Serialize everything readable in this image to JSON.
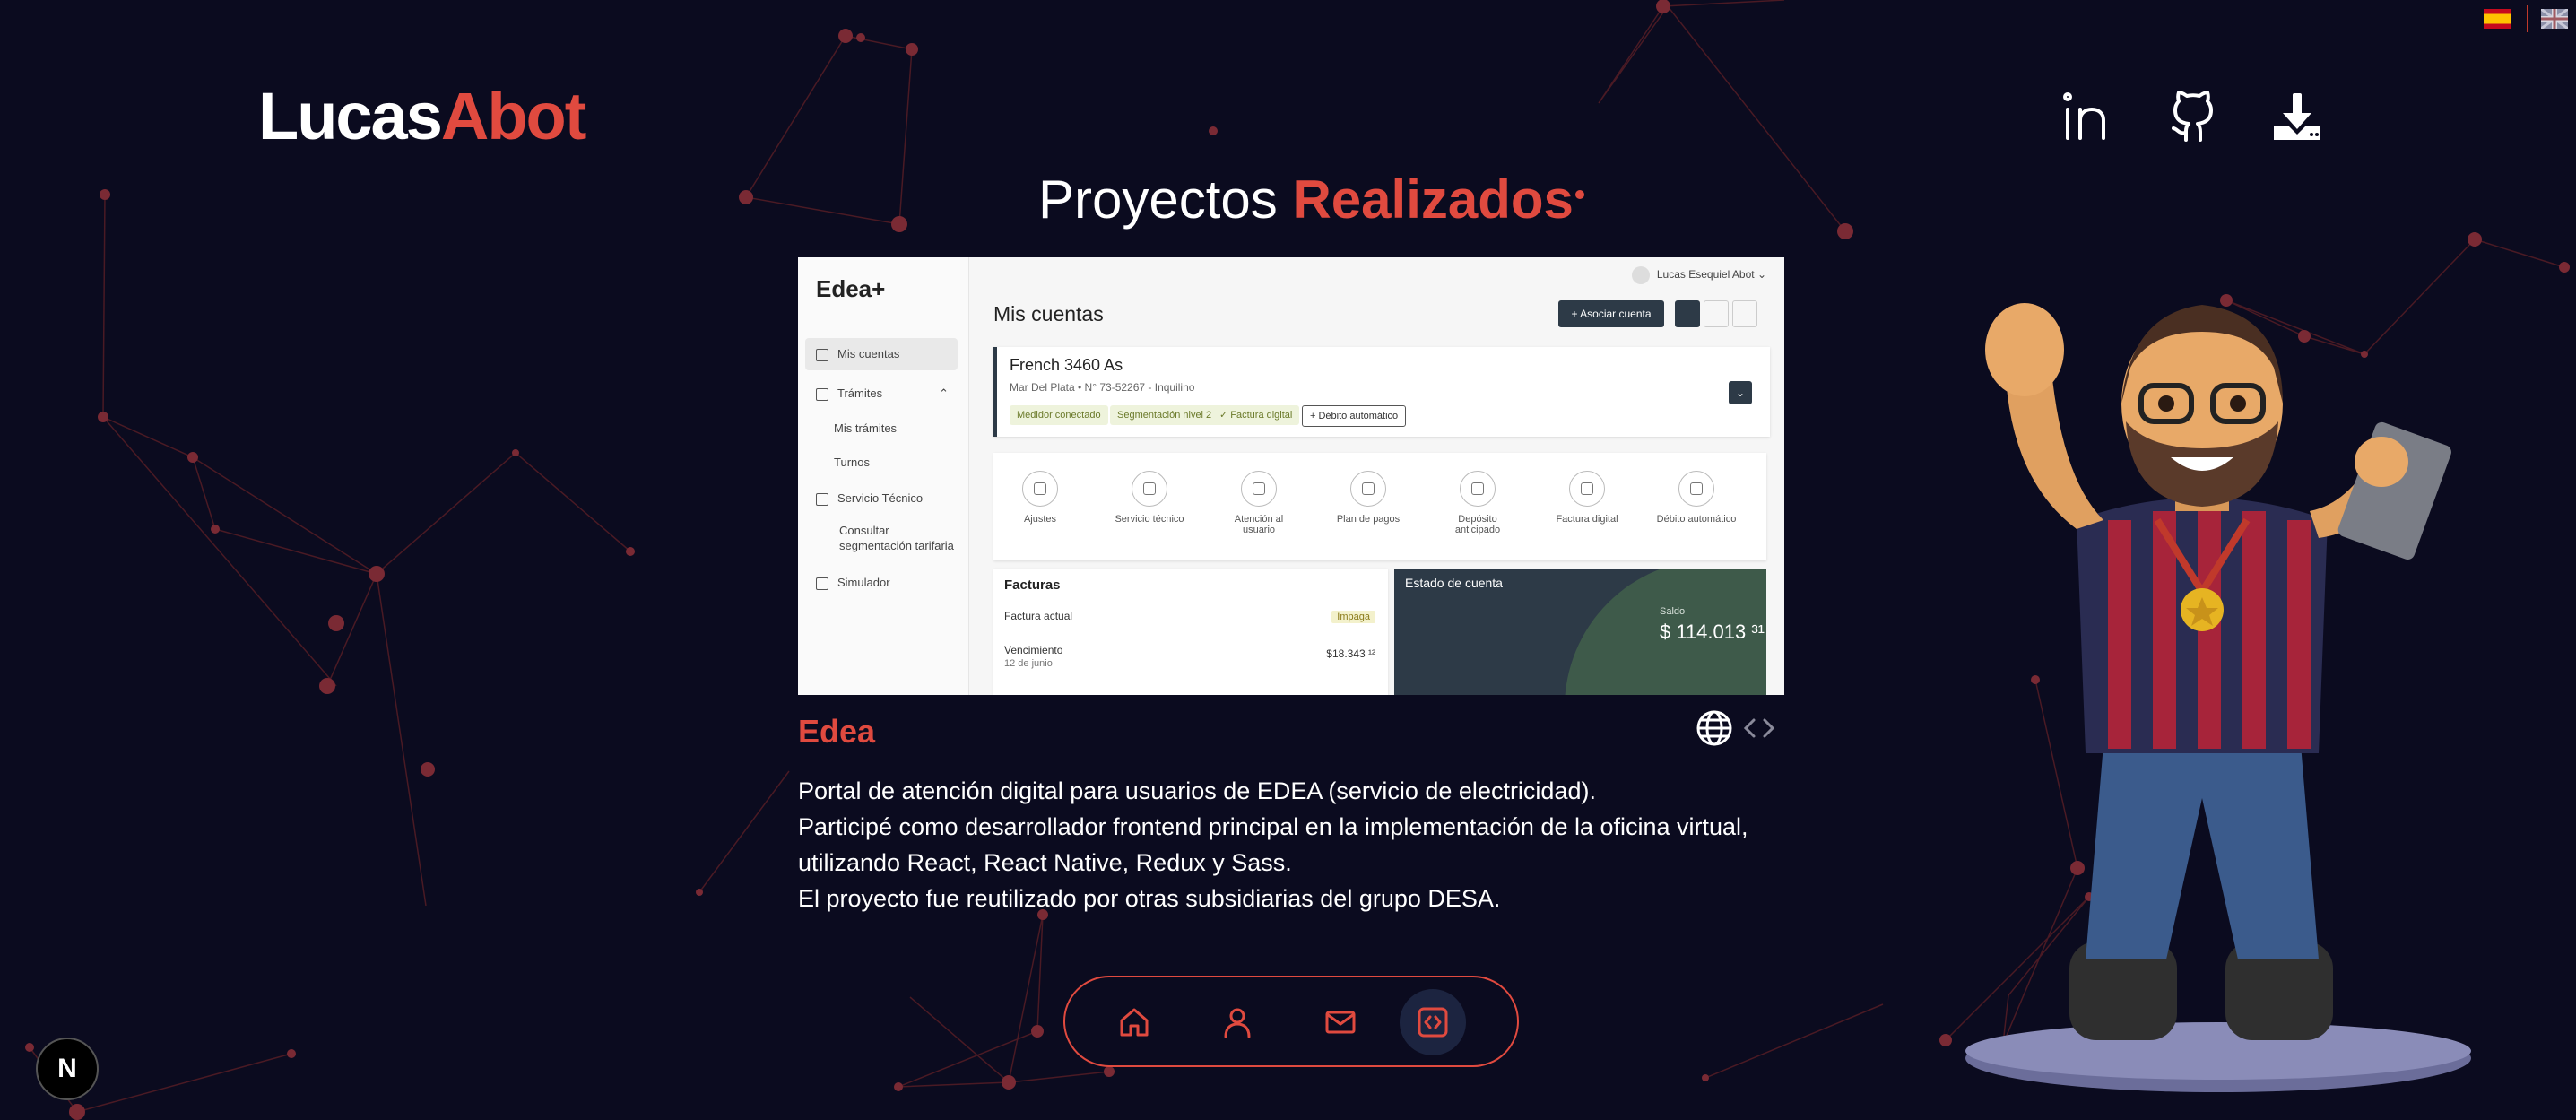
{
  "header": {
    "logo_first": "Lucas",
    "logo_second": "Abot",
    "languages": [
      "es",
      "en"
    ],
    "social": [
      {
        "name": "linkedin-icon"
      },
      {
        "name": "github-icon"
      },
      {
        "name": "download-icon"
      }
    ]
  },
  "section": {
    "title_white": "Proyectos",
    "title_red": "Realizados"
  },
  "screenshot": {
    "brand": "Edea+",
    "sidebar": [
      "Mis cuentas",
      "Trámites",
      "Mis trámites",
      "Turnos",
      "Servicio Técnico",
      "Consultar segmentación tarifaria",
      "Simulador"
    ],
    "user_name": "Lucas Esequiel Abot",
    "page_title": "Mis cuentas",
    "assoc_button": "+ Asociar cuenta",
    "account": {
      "title": "French 3460 As",
      "subtitle": "Mar Del Plata  •  N° 73-52267 - Inquilino",
      "tags": [
        "Medidor conectado",
        "Segmentación nivel 2",
        "✓ Factura digital",
        "+ Débito automático"
      ]
    },
    "services": [
      "Ajustes",
      "Servicio técnico",
      "Atención al usuario",
      "Plan de pagos",
      "Depósito anticipado",
      "Factura digital",
      "Débito automático"
    ],
    "facturas": {
      "title": "Facturas",
      "actual_label": "Factura actual",
      "actual_status": "Impaga",
      "venc_label": "Vencimiento",
      "venc_date": "12 de junio",
      "venc_amount": "$18.343 ¹²"
    },
    "estado": {
      "title": "Estado de cuenta",
      "saldo_label": "Saldo",
      "saldo_value": "$ 114.013 ³¹"
    }
  },
  "project": {
    "name": "Edea",
    "description": [
      "Portal de atención digital para usuarios de EDEA (servicio de electricidad).",
      "Participé como desarrollador frontend principal en la implementación de la oficina virtual,",
      "utilizando React, React Native, Redux y Sass.",
      "El proyecto fue reutilizado por otras subsidiarias del grupo DESA."
    ]
  },
  "bottom_nav": [
    {
      "name": "home-icon",
      "active": false
    },
    {
      "name": "user-icon",
      "active": false
    },
    {
      "name": "mail-icon",
      "active": false
    },
    {
      "name": "code-icon",
      "active": true
    }
  ],
  "framework_badge": "N",
  "colors": {
    "accent": "#e04a3f",
    "background": "#0b0b1f",
    "line": "#5a1f2a"
  }
}
